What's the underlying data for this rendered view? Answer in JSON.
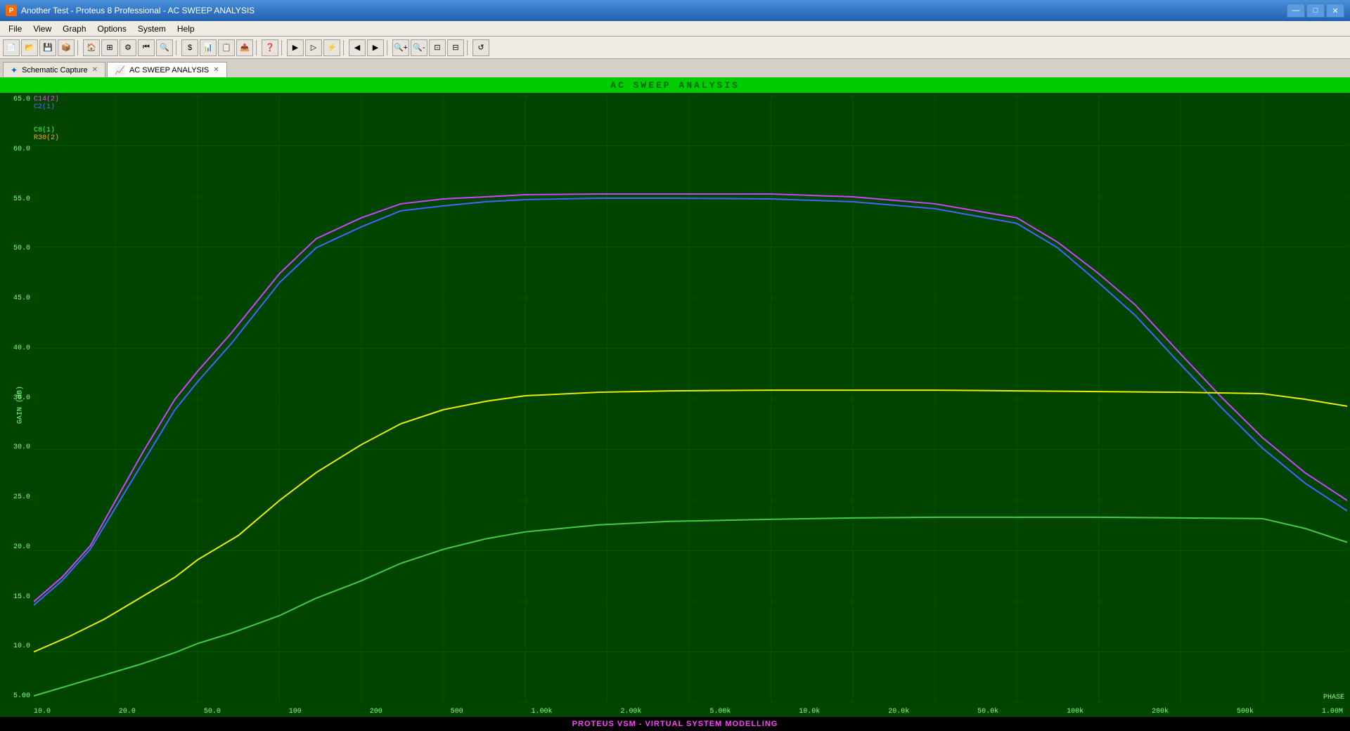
{
  "window": {
    "title": "Another Test - Proteus 8 Professional - AC SWEEP ANALYSIS",
    "icon": "P"
  },
  "titlebar": {
    "minimize": "—",
    "maximize": "□",
    "close": "✕"
  },
  "menubar": {
    "items": [
      "File",
      "View",
      "Graph",
      "Options",
      "System",
      "Help"
    ]
  },
  "tabs": [
    {
      "id": "schematic",
      "label": "Schematic Capture",
      "active": false,
      "color": "#0066cc"
    },
    {
      "id": "acsweep",
      "label": "AC SWEEP ANALYSIS",
      "active": true,
      "color": "#cc4400"
    }
  ],
  "graph": {
    "header": "AC  SWEEP  ANALYSIS",
    "yaxis": {
      "label": "GAIN (dB)",
      "values": [
        "65.0",
        "60.0",
        "55.0",
        "50.0",
        "45.0",
        "40.0",
        "35.0",
        "30.0",
        "25.0",
        "20.0",
        "15.0",
        "10.0",
        "5.00"
      ]
    },
    "xaxis": {
      "values": [
        "10.0",
        "20.0",
        "50.0",
        "100",
        "200",
        "500",
        "1.00k",
        "2.00k",
        "5.00k",
        "10.0k",
        "20.0k",
        "50.0k",
        "100k",
        "200k",
        "500k",
        "1.00M"
      ]
    },
    "legend": [
      {
        "label": "C14(2)",
        "color": "#ff44ff"
      },
      {
        "label": "C2(1)",
        "color": "#4444ff"
      },
      {
        "label": "C8(1)",
        "color": "#44ff44"
      },
      {
        "label": "R30(2)",
        "color": "#ffff44"
      }
    ],
    "phase_label": "PHASE"
  },
  "statusbar": {
    "text": "PROTEUS VSM - VIRTUAL SYSTEM MODELLING"
  }
}
